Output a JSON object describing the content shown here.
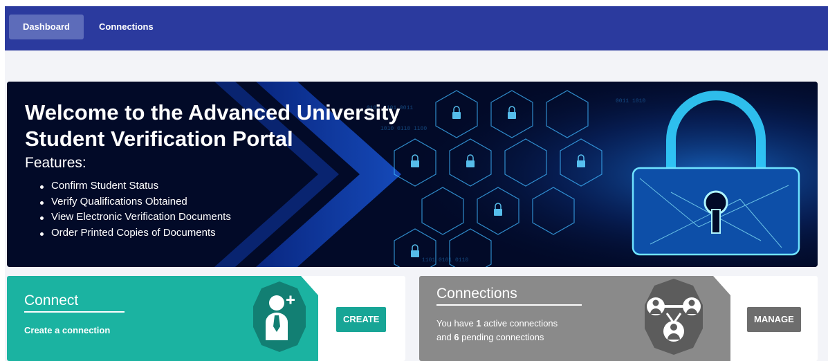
{
  "nav": {
    "items": [
      {
        "label": "Dashboard",
        "active": true
      },
      {
        "label": "Connections",
        "active": false
      }
    ]
  },
  "hero": {
    "title": "Welcome to the Advanced University Student Verification Portal",
    "subtitle": "Features:",
    "features": [
      "Confirm Student Status",
      "Verify Qualifications Obtained",
      "View Electronic Verification Documents",
      "Order Printed Copies of Documents"
    ],
    "image_icon": "padlock-network-icon"
  },
  "cards": {
    "connect": {
      "title": "Connect",
      "text": "Create a connection",
      "button": "CREATE",
      "icon": "add-user-icon",
      "color": "#1bb3a1"
    },
    "connections": {
      "title": "Connections",
      "line1_prefix": "You have ",
      "active_count": "1",
      "line1_suffix": " active connections",
      "line2_prefix": "and ",
      "pending_count": "6",
      "line2_suffix": " pending connections",
      "button": "MANAGE",
      "icon": "group-network-icon",
      "color": "#8a8a8a"
    }
  },
  "colors": {
    "topbar": "#2b3a9e",
    "nav_active": "#5d6cba",
    "page_bg": "#f3f4f8",
    "hero_bg": "#020a28",
    "accent_cyan": "#2fc8ff"
  }
}
